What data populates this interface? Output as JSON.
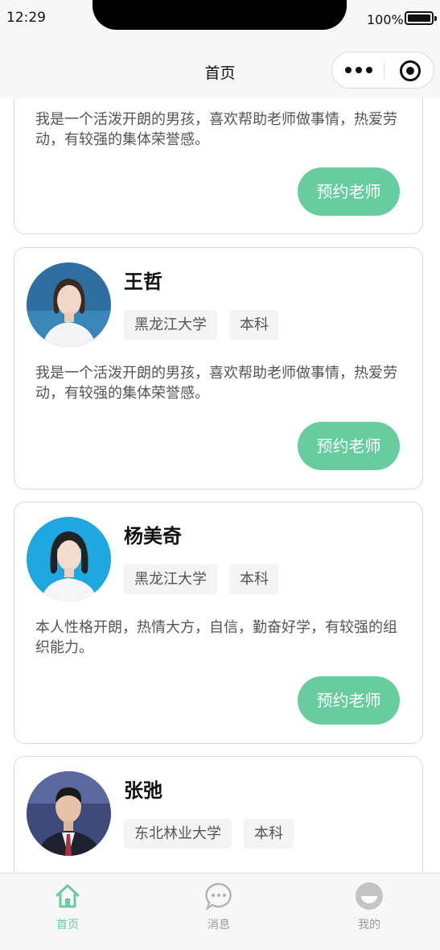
{
  "status_bar": {
    "time": "12:29",
    "battery": "100%"
  },
  "nav": {
    "title": "首页"
  },
  "accent_color": "#67cd9e",
  "teachers": [
    {
      "name": "",
      "tags": [],
      "description": "我是一个活泼开朗的男孩，喜欢帮助老师做事情，热爱劳动，有较强的集体荣誉感。",
      "button": "预约老师"
    },
    {
      "name": "王哲",
      "tags": [
        "黑龙江大学",
        "本科"
      ],
      "description": "我是一个活泼开朗的男孩，喜欢帮助老师做事情，热爱劳动，有较强的集体荣誉感。",
      "button": "预约老师"
    },
    {
      "name": "杨美奇",
      "tags": [
        "黑龙江大学",
        "本科"
      ],
      "description": "本人性格开朗，热情大方，自信，勤奋好学，有较强的组织能力。",
      "button": "预约老师"
    },
    {
      "name": "张弛",
      "tags": [
        "东北林业大学",
        "本科"
      ]
    }
  ],
  "tabbar": {
    "items": [
      {
        "label": "首页",
        "icon": "home-icon",
        "active": true
      },
      {
        "label": "消息",
        "icon": "message-icon",
        "active": false
      },
      {
        "label": "我的",
        "icon": "profile-icon",
        "active": false
      }
    ]
  }
}
